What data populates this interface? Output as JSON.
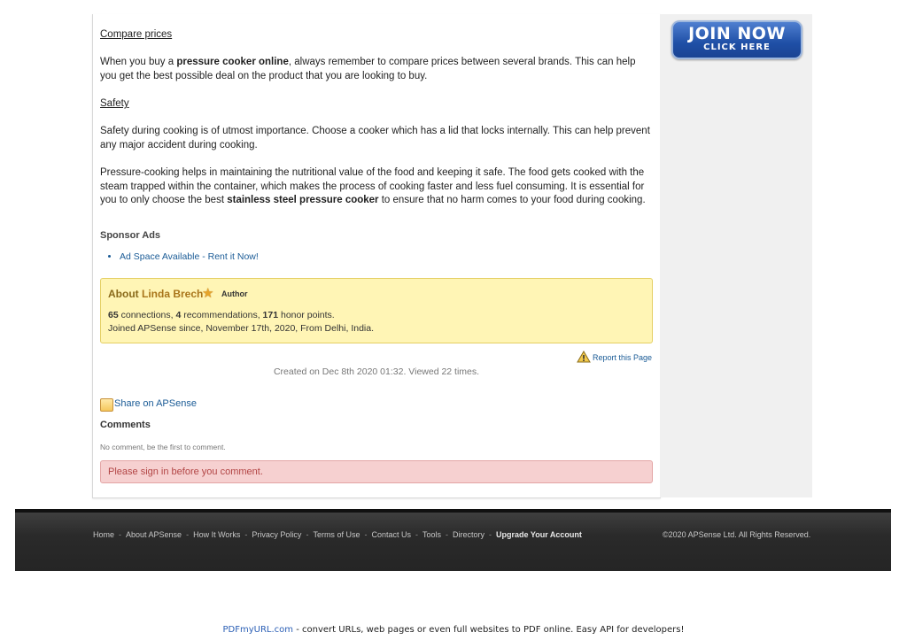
{
  "article": {
    "compare_heading": "Compare prices",
    "compare_pre": "When you buy a ",
    "compare_bold": "pressure cooker online",
    "compare_post": ", always remember to compare prices between several brands. This can help you get the best possible deal on the product that you are looking to buy.",
    "safety_heading": "Safety",
    "safety_text": "Safety during cooking is of utmost importance. Choose a cooker which has a lid that locks internally. This can help prevent any major accident during cooking.",
    "pressure_pre": "Pressure-cooking helps in maintaining the nutritional value of the food and keeping it safe. The food gets cooked with the steam trapped within the container, which makes the process of cooking faster and less fuel consuming. It is essential for you to only choose the best ",
    "pressure_bold": "stainless steel pressure cooker",
    "pressure_post": " to ensure that no harm comes to your food during cooking."
  },
  "sponsor": {
    "title": "Sponsor Ads",
    "items": [
      "Ad Space Available - Rent it Now!"
    ]
  },
  "author": {
    "about_prefix": "About ",
    "name": "Linda Brech",
    "role": "Author",
    "connections": "65",
    "connections_label": " connections, ",
    "recommendations": "4",
    "recommendations_label": " recommendations, ",
    "honor": "171",
    "honor_label": " honor points.",
    "joined": "Joined APSense since, November 17th, 2020, From Delhi, India."
  },
  "meta": {
    "report_label": "Report this Page",
    "created": "Created on Dec 8th 2020 01:32. Viewed 22 times."
  },
  "share": {
    "label": "Share on APSense",
    "icon": "share-icon"
  },
  "comments": {
    "title": "Comments",
    "empty": "No comment, be the first to comment.",
    "signin": "Please sign in before you comment."
  },
  "sidebar": {
    "join_main": "JOIN NOW",
    "join_sub": "CLICK HERE"
  },
  "footer": {
    "links": [
      "Home",
      "About APSense",
      "How It Works",
      "Privacy Policy",
      "Terms of Use",
      "Contact Us",
      "Tools",
      "Directory"
    ],
    "upgrade": "Upgrade Your Account",
    "copyright": "©2020 APSense Ltd. All Rights Reserved."
  },
  "pdf_notice": {
    "link": "PDFmyURL.com",
    "text": " - convert URLs, web pages or even full websites to PDF online. Easy API for developers!"
  },
  "colors": {
    "link": "#1a5b96",
    "author_box": "#fff5b5",
    "signin_box": "#f6d0d0",
    "footer": "#2a2a2a",
    "join_button": "#1f4fa6"
  }
}
